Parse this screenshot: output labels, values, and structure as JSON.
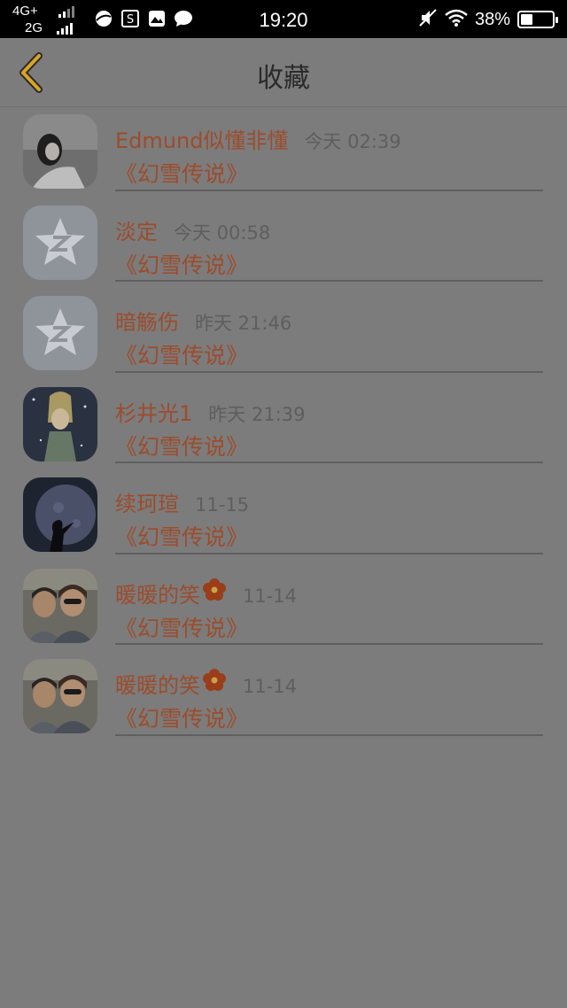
{
  "status_bar": {
    "network_top": "4G+",
    "network_bottom": "2G",
    "time": "19:20",
    "battery_percent": "38%",
    "battery_level": 0.38,
    "app_icons": [
      "browser-icon",
      "s-app-icon",
      "gallery-icon",
      "chat-bubble-icon"
    ]
  },
  "header": {
    "title": "收藏",
    "back_icon": "chevron-left-icon",
    "accent_color": "#d9a425"
  },
  "colors": {
    "name": "#9c4c2c",
    "time": "#5e5e5e",
    "background": "#7c7c7c"
  },
  "favorites": [
    {
      "name": "Edmund似懂非懂",
      "time": "今天 02:39",
      "book": "《幻雪传说》",
      "avatar": "photo-girl-avatar",
      "flower": false
    },
    {
      "name": "淡定",
      "time": "今天 00:58",
      "book": "《幻雪传说》",
      "avatar": "default-qq-avatar",
      "flower": false
    },
    {
      "name": "暗觞伤",
      "time": "昨天 21:46",
      "book": "《幻雪传说》",
      "avatar": "default-qq-avatar",
      "flower": false
    },
    {
      "name": "杉井光1",
      "time": "昨天 21:39",
      "book": "《幻雪传说》",
      "avatar": "anime-girl-avatar",
      "flower": false
    },
    {
      "name": "续珂瑄",
      "time": "11-15",
      "book": "《幻雪传说》",
      "avatar": "moon-silhouette-avatar",
      "flower": false
    },
    {
      "name": "暖暖的笑",
      "time": "11-14",
      "book": "《幻雪传说》",
      "avatar": "mother-daughter-avatar",
      "flower": true
    },
    {
      "name": "暖暖的笑",
      "time": "11-14",
      "book": "《幻雪传说》",
      "avatar": "mother-daughter-avatar",
      "flower": true
    }
  ]
}
